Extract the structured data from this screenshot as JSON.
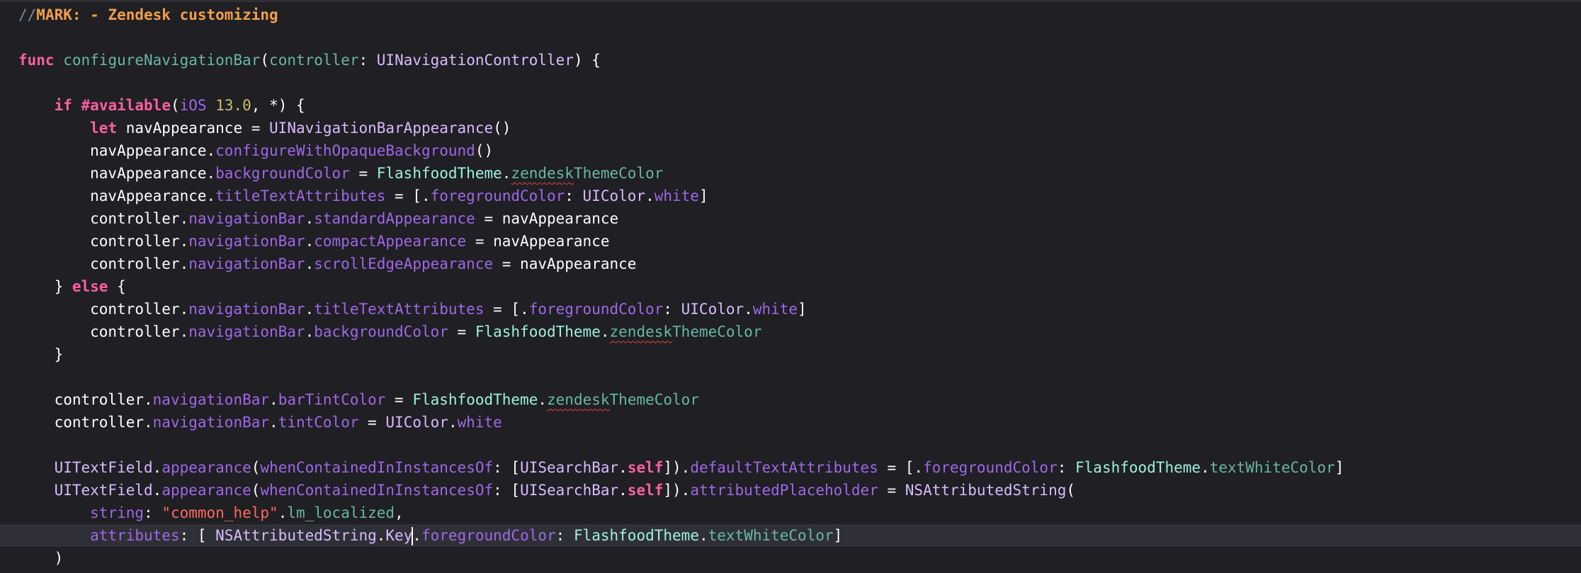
{
  "editor": {
    "lines": [
      {
        "t": "//MARK: - Zendesk customizing"
      },
      {
        "t": ""
      },
      {
        "t": "func configureNavigationBar(controller: UINavigationController) {"
      },
      {
        "t": ""
      },
      {
        "t": "    if #available(iOS 13.0, *) {"
      },
      {
        "t": "        let navAppearance = UINavigationBarAppearance()"
      },
      {
        "t": "        navAppearance.configureWithOpaqueBackground()"
      },
      {
        "t": "        navAppearance.backgroundColor = FlashfoodTheme.zendeskThemeColor"
      },
      {
        "t": "        navAppearance.titleTextAttributes = [.foregroundColor: UIColor.white]"
      },
      {
        "t": "        controller.navigationBar.standardAppearance = navAppearance"
      },
      {
        "t": "        controller.navigationBar.compactAppearance = navAppearance"
      },
      {
        "t": "        controller.navigationBar.scrollEdgeAppearance = navAppearance"
      },
      {
        "t": "    } else {"
      },
      {
        "t": "        controller.navigationBar.titleTextAttributes = [.foregroundColor: UIColor.white]"
      },
      {
        "t": "        controller.navigationBar.backgroundColor = FlashfoodTheme.zendeskThemeColor"
      },
      {
        "t": "    }"
      },
      {
        "t": ""
      },
      {
        "t": "    controller.navigationBar.barTintColor = FlashfoodTheme.zendeskThemeColor"
      },
      {
        "t": "    controller.navigationBar.tintColor = UIColor.white"
      },
      {
        "t": ""
      },
      {
        "t": "    UITextField.appearance(whenContainedInInstancesOf: [UISearchBar.self]).defaultTextAttributes = [.foregroundColor: FlashfoodTheme.textWhiteColor]"
      },
      {
        "t": "    UITextField.appearance(whenContainedInInstancesOf: [UISearchBar.self]).attributedPlaceholder = NSAttributedString("
      },
      {
        "t": "        string: \"common_help\".lm_localized,"
      },
      {
        "t": "        attributes: [ NSAttributedString.Key.foregroundColor: FlashfoodTheme.textWhiteColor]"
      },
      {
        "t": "    )"
      }
    ],
    "current_line_index": 23
  },
  "colors": {
    "background": "#1f1f24",
    "current_line": "#2f3037",
    "keyword": "#fc5fa3",
    "mark": "#f29e4a",
    "comment": "#7f8c98",
    "function_decl": "#67b7a4",
    "type": "#d0a8ff",
    "member": "#a167e6",
    "project_type": "#9ef1dd",
    "number": "#d0bf69",
    "string": "#fc6a5d",
    "error_squiggle": "#e3433c"
  }
}
